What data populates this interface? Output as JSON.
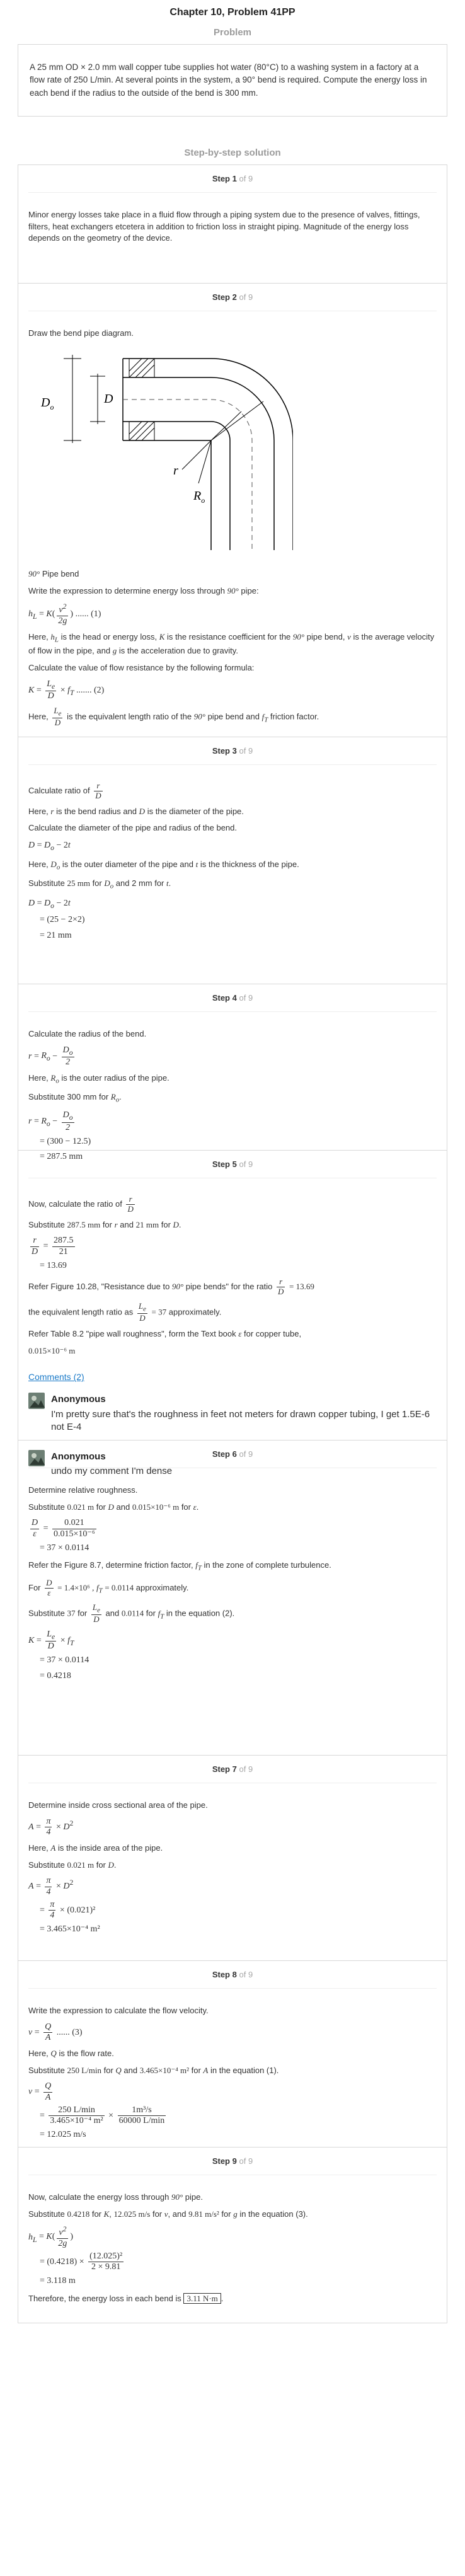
{
  "header": {
    "title": "Chapter 10, Problem 41PP",
    "problem_heading": "Problem",
    "solution_heading": "Step-by-step solution"
  },
  "problem": {
    "text": "A 25 mm OD × 2.0 mm wall copper tube supplies hot water (80°C) to a washing system in a factory at a flow rate of 250 L/min. At several points in the system, a 90° bend is required. Compute the energy loss in each bend if the radius to the outside of the bend is 300 mm."
  },
  "step_label": "Step",
  "of_label": "of 9",
  "steps": {
    "s1": {
      "num": "1",
      "text": "Minor energy losses take place in a fluid flow through a piping system due to the presence of valves, fittings, filters, heat exchangers etcetera in addition to friction loss in straight piping. Magnitude of the energy loss depends on the geometry of the device."
    },
    "s2": {
      "num": "2",
      "intro": "Draw the bend pipe diagram.",
      "diagram_labels": {
        "do": "D",
        "do_sub": "o",
        "d": "D",
        "r": "r",
        "ro": "R",
        "ro_sub": "o"
      },
      "caption_sym": "90°",
      "caption": "Pipe bend",
      "l1_a": "Write the expression to determine energy loss through",
      "l1_b": "pipe:",
      "eq1_num": "...... (1)",
      "l2_a": "Here,",
      "l2_b": "is the head or energy loss,",
      "l2_c": "is the resistance coefficient for the",
      "l2_d": "pipe bend,",
      "l2_e": "is the average velocity of flow in the pipe, and",
      "l2_f": "is the acceleration due to gravity.",
      "l3": "Calculate the value of flow resistance by the following formula:",
      "eq2_num": "....... (2)",
      "l4_a": "Here,",
      "l4_b": "is the equivalent length ratio of the",
      "l4_c": "pipe bend and",
      "l4_d": "friction factor."
    },
    "s3": {
      "num": "3",
      "l1": "Calculate ratio of",
      "l2_a": "Here,",
      "l2_b": "is the bend radius and",
      "l2_c": "is the diameter of the pipe.",
      "l3": "Calculate the diameter of the pipe and radius of the bend.",
      "l4_a": "Here,",
      "l4_b": "is the outer diameter of the pipe and",
      "l4_c": "is the thickness of the pipe.",
      "l5_a": "Substitute",
      "l5_v1": "25 mm",
      "l5_b": "for",
      "l5_c": "and 2 mm for",
      "e2": "= (25 − 2×2)",
      "e3": "= 21 mm"
    },
    "s4": {
      "num": "4",
      "l1": "Calculate the radius of the bend.",
      "l2_a": "Here,",
      "l2_b": "is the outer radius of the pipe.",
      "l3_a": "Substitute 300 mm for",
      "e3": "= (300 − 12.5)",
      "e4": "= 287.5 mm"
    },
    "s5": {
      "num": "5",
      "l1": "Now, calculate the ratio of",
      "l2_a": "Substitute",
      "l2_v1": "287.5 mm",
      "l2_b": "for",
      "l2_c": "and",
      "l2_v2": "21 mm",
      "l2_d": "for",
      "num1": "287.5",
      "den1": "21",
      "e2": "= 13.69",
      "l3_a": "Refer Figure",
      "l3_fig": "10.28",
      "l3_b": ", \"Resistance due to",
      "l3_c": "pipe bends\" for the ratio",
      "l3_val": "= 13.69",
      "l4_a": "the equivalent length ratio as",
      "l4_val": "= 37",
      "l4_b": "approximately.",
      "l5_a": "Refer Table",
      "l5_tab": "8.2",
      "l5_b": "\"pipe wall roughness\", form the Text book",
      "l5_c": "for copper tube,",
      "l6": "0.015×10⁻⁶ m",
      "comments_link": "Comments (2)",
      "comments": [
        {
          "author": "Anonymous",
          "text": "I'm pretty sure that's the roughness in feet not meters for drawn copper tubing, I get 1.5E-6 not E-4"
        },
        {
          "author": "Anonymous",
          "text": "undo my comment I'm dense"
        }
      ]
    },
    "s6": {
      "num": "6",
      "l1": "Determine relative roughness.",
      "l2_a": "Substitute",
      "l2_v1": "0.021 m",
      "l2_b": "for",
      "l2_c": "and",
      "l2_v2": "0.015×10⁻⁶ m",
      "l2_d": "for",
      "num1": "0.021",
      "den1": "0.015×10⁻⁶",
      "e2": "= 37 × 0.0114",
      "l3_a": "Refer the Figure",
      "l3_fig": "8.7",
      "l3_b": ", determine friction factor,",
      "l3_c": "in the zone of complete turbulence.",
      "l4_a": "For",
      "l4_v1": "= 1.4×10⁶ ,",
      "l4_v2": "= 0.0114",
      "l4_b": "approximately.",
      "l5_a": "Substitute",
      "l5_v1": "37",
      "l5_b": "for",
      "l5_c": "and",
      "l5_v2": "0.0114",
      "l5_d": "for",
      "l5_e": "in the equation (2).",
      "e3": "= 0.4218"
    },
    "s7": {
      "num": "7",
      "l1": "Determine inside cross sectional area of the pipe.",
      "l2_a": "Here,",
      "l2_b": "is the inside area of the pipe.",
      "l3_a": "Substitute",
      "l3_v1": "0.021 m",
      "l3_b": "for",
      "e2_tail": "× (0.021)²",
      "e3": "= 3.465×10⁻⁴ m²"
    },
    "s8": {
      "num": "8",
      "l1": "Write the expression to calculate the flow velocity.",
      "eq_num": "...... (3)",
      "l2_a": "Here,",
      "l2_b": "is the flow rate.",
      "l3_a": "Substitute",
      "l3_v1": "250 L/min",
      "l3_b": "for",
      "l3_c": "and",
      "l3_v2": "3.465×10⁻⁴ m²",
      "l3_d": "for",
      "l3_e": "in the equation (1).",
      "num1": "250 L/min",
      "den1": "3.465×10⁻⁴ m²",
      "num2": "1m³/s",
      "den2": "60000 L/min",
      "e3": "= 12.025 m/s"
    },
    "s9": {
      "num": "9",
      "l1_a": "Now, calculate the energy loss through",
      "l1_b": "pipe.",
      "l2_a": "Substitute",
      "l2_v1": "0.4218",
      "l2_b": "for",
      "l2_c": ",",
      "l2_v2": "12.025 m/s",
      "l2_d": "for",
      "l2_e": ", and",
      "l2_v3": "9.81 m/s²",
      "l2_f": "for",
      "l2_g": "in the equation (3).",
      "e2_a": "= (0.4218) ×",
      "num2": "(12.025)²",
      "den2": "2 × 9.81",
      "e3": "= 3.118 m",
      "l3": "Therefore, the energy loss in each bend is",
      "answer": "3.11 N·m"
    }
  }
}
